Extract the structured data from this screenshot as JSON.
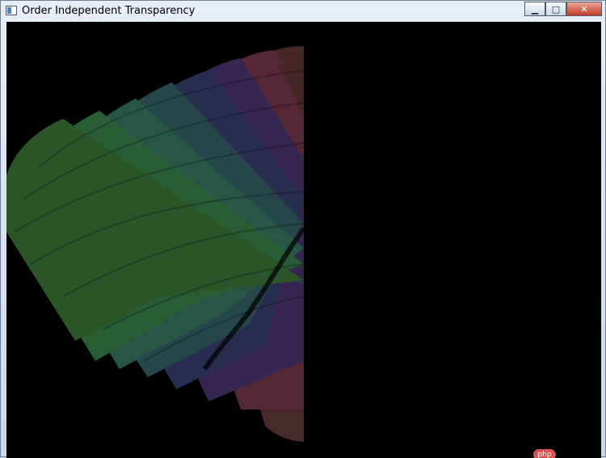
{
  "window": {
    "title": "Order Independent Transparency",
    "controls": {
      "minimize": "▁",
      "maximize": "□",
      "close": "✕"
    }
  },
  "render": {
    "background": "#000000",
    "colors": [
      "#6b2a2a",
      "#5b2a4a",
      "#3b2a55",
      "#2b3455",
      "#2a4c54",
      "#2b5e55",
      "#355f2f",
      "#3c6b2d",
      "#2f7a43",
      "#2f8b6a"
    ]
  },
  "watermark": {
    "text": "php"
  }
}
